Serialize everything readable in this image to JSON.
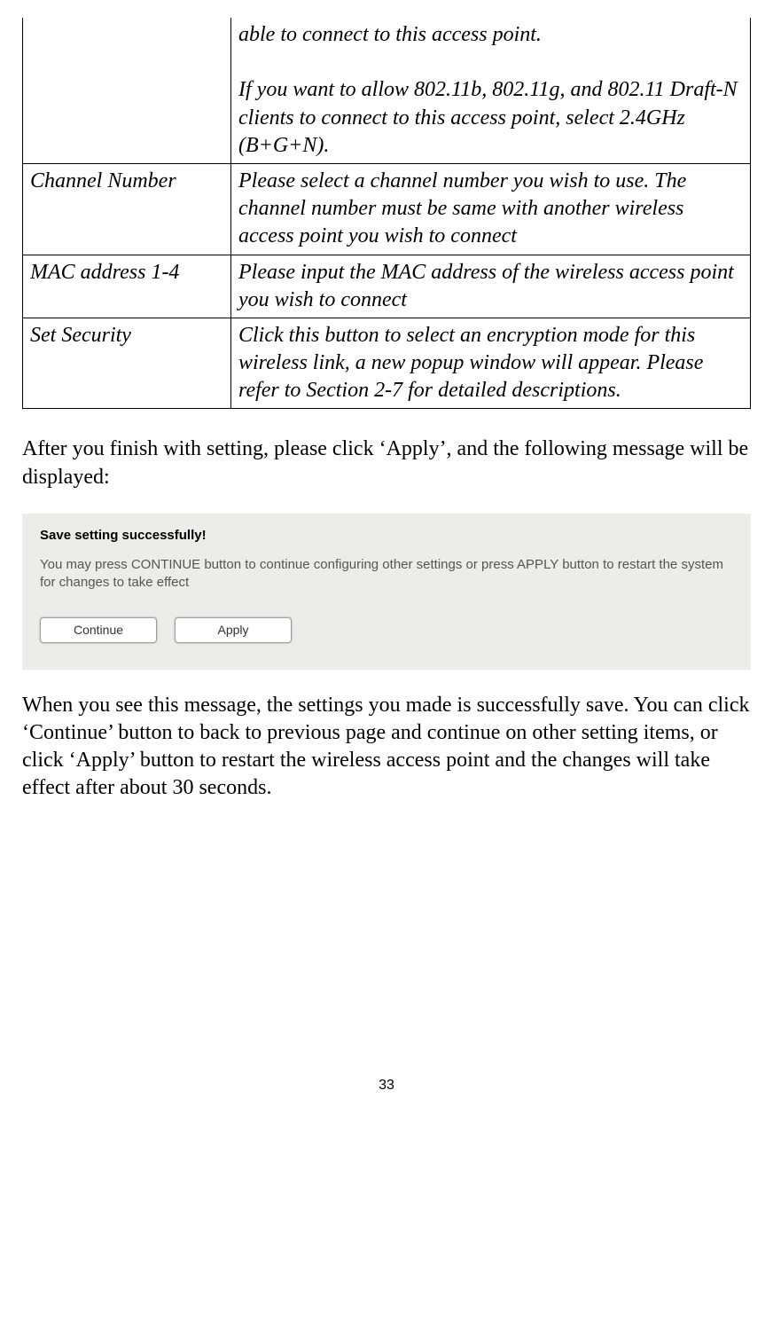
{
  "table": {
    "rows": [
      {
        "label": "",
        "desc": "able to connect to this access point.\n\nIf you want to allow 802.11b, 802.11g, and 802.11 Draft-N clients to connect to this access point, select 2.4GHz (B+G+N)."
      },
      {
        "label": "Channel  Number",
        "desc": "Please select a channel number you wish to use. The channel number must be same with another wireless access point you wish to connect"
      },
      {
        "label": "MAC address 1-4",
        "desc": "Please input the MAC address of the wireless access point you wish to connect"
      },
      {
        "label": "Set Security",
        "desc": "Click this button to select an encryption mode for this wireless link, a new popup window will appear. Please refer to Section 2-7 for detailed descriptions."
      }
    ]
  },
  "paragraph1": "After you finish with setting, please click ‘Apply’, and the following message will be displayed:",
  "dialog": {
    "title": "Save setting successfully!",
    "text": "You may press CONTINUE button to continue configuring other settings or press APPLY button to restart the system for changes to take effect",
    "continue_label": "Continue",
    "apply_label": "Apply"
  },
  "paragraph2": "When you see this message, the settings you made is successfully save. You can click ‘Continue’ button to back to previous page and continue on other setting items, or click ‘Apply’ button to restart the wireless access point and the changes will take effect after about 30 seconds.",
  "page_number": "33"
}
